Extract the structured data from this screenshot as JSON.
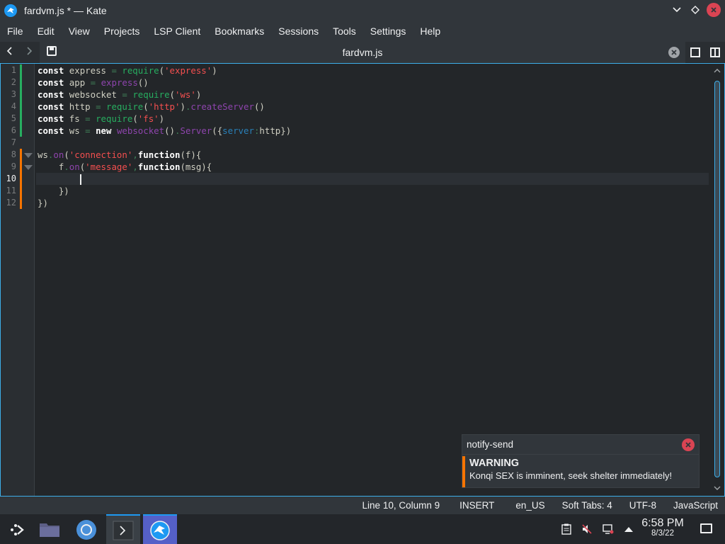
{
  "window": {
    "title": "fardvm.js * — Kate"
  },
  "menu": [
    "File",
    "Edit",
    "View",
    "Projects",
    "LSP Client",
    "Bookmarks",
    "Sessions",
    "Tools",
    "Settings",
    "Help"
  ],
  "tab": {
    "label": "fardvm.js"
  },
  "editor": {
    "line_numbers": [
      "1",
      "2",
      "3",
      "4",
      "5",
      "6",
      "7",
      "8",
      "9",
      "10",
      "11",
      "12"
    ],
    "current_line": 10
  },
  "notification": {
    "app": "notify-send",
    "title": "WARNING",
    "body": "Konqi SEX is imminent, seek shelter immediately!"
  },
  "status": {
    "position": "Line 10, Column 9",
    "mode": "INSERT",
    "language_dict": "en_US",
    "indent": "Soft Tabs: 4",
    "encoding": "UTF-8",
    "syntax": "JavaScript"
  },
  "taskbar": {
    "time": "6:58 PM",
    "date": "8/3/22"
  },
  "colors": {
    "accent": "#3daee9",
    "close": "#da4453",
    "warning": "#f67400"
  }
}
